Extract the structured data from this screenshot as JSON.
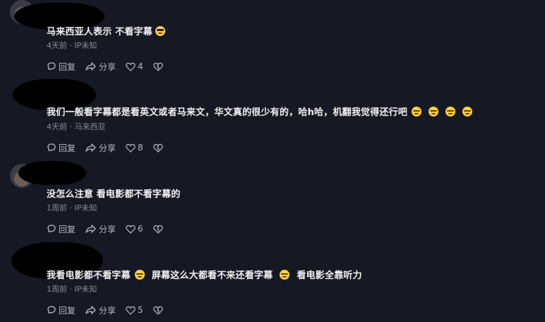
{
  "comments": [
    {
      "text_parts": [
        "马来西亚人表示 不看字幕",
        ""
      ],
      "emojis": [
        "cool-emoji"
      ],
      "time": "4天前",
      "location": "IP未知",
      "reply_label": "回复",
      "share_label": "分享",
      "likes": "4"
    },
    {
      "text_parts": [
        "我们一般看字幕都是看英文或者马来文，华文真的很少有的，哈h哈，机翻我觉得还行吧"
      ],
      "emojis": [
        "laugh-emoji",
        "laugh-emoji",
        "laugh-emoji",
        "laugh-emoji"
      ],
      "time": "4天前",
      "location": "马来西亚",
      "reply_label": "回复",
      "share_label": "分享",
      "likes": "8"
    },
    {
      "text_parts": [
        "没怎么注意 看电影都不看字幕的"
      ],
      "emojis": [],
      "time": "1周前",
      "location": "IP未知",
      "reply_label": "回复",
      "share_label": "分享",
      "likes": "6"
    },
    {
      "text_parts": [
        "我看电影都不看字幕",
        "屏幕这么大都看不来还看字幕",
        "看电影全靠听力"
      ],
      "emojis": [
        "laugh-emoji",
        "laugh-emoji"
      ],
      "time": "1周前",
      "location": "IP未知",
      "reply_label": "回复",
      "share_label": "分享",
      "likes": "5"
    }
  ],
  "separator": "·",
  "colors": {
    "background": "#161823",
    "text": "#f2f2f5",
    "meta": "#8a8b96"
  }
}
